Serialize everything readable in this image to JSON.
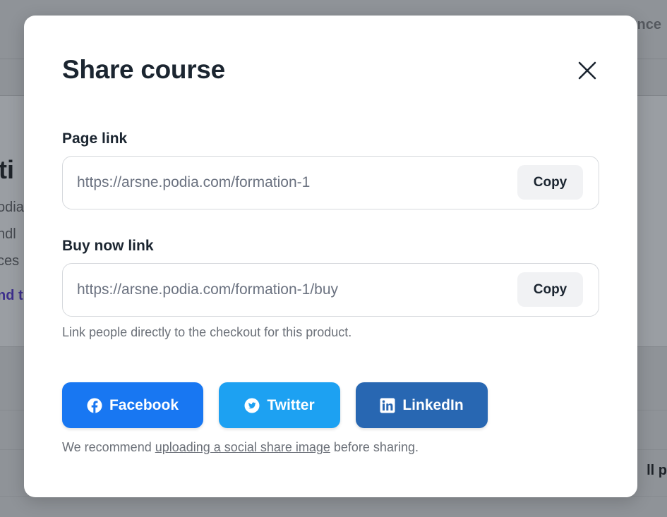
{
  "background": {
    "top_right_fragment": "nce",
    "title_fragment": "ti",
    "lines": [
      "odia",
      "ndl",
      "ces"
    ],
    "link_fragment": "nd th",
    "right_button_fragment": "ll pro"
  },
  "modal": {
    "title": "Share course",
    "close_icon": "close-icon",
    "page_link": {
      "label": "Page link",
      "value": "https://arsne.podia.com/formation-1",
      "copy_label": "Copy"
    },
    "buy_link": {
      "label": "Buy now link",
      "value": "https://arsne.podia.com/formation-1/buy",
      "copy_label": "Copy",
      "help": "Link people directly to the checkout for this product."
    },
    "social": {
      "facebook": {
        "label": "Facebook",
        "icon": "facebook-icon",
        "color": "#1877f2"
      },
      "twitter": {
        "label": "Twitter",
        "icon": "twitter-icon",
        "color": "#1da1f2"
      },
      "linkedin": {
        "label": "LinkedIn",
        "icon": "linkedin-icon",
        "color": "#2867b2"
      }
    },
    "recommend": {
      "prefix": "We recommend ",
      "link": "uploading a social share image",
      "suffix": " before sharing."
    }
  }
}
